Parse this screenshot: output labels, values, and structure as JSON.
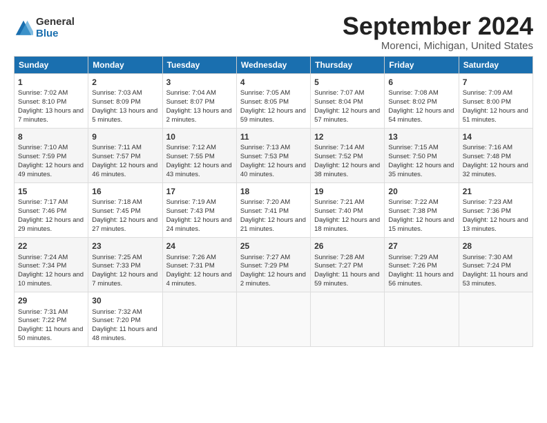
{
  "logo": {
    "general": "General",
    "blue": "Blue"
  },
  "title": "September 2024",
  "location": "Morenci, Michigan, United States",
  "days_of_week": [
    "Sunday",
    "Monday",
    "Tuesday",
    "Wednesday",
    "Thursday",
    "Friday",
    "Saturday"
  ],
  "weeks": [
    [
      {
        "day": "1",
        "sunrise": "7:02 AM",
        "sunset": "8:10 PM",
        "daylight": "13 hours and 7 minutes."
      },
      {
        "day": "2",
        "sunrise": "7:03 AM",
        "sunset": "8:09 PM",
        "daylight": "13 hours and 5 minutes."
      },
      {
        "day": "3",
        "sunrise": "7:04 AM",
        "sunset": "8:07 PM",
        "daylight": "13 hours and 2 minutes."
      },
      {
        "day": "4",
        "sunrise": "7:05 AM",
        "sunset": "8:05 PM",
        "daylight": "12 hours and 59 minutes."
      },
      {
        "day": "5",
        "sunrise": "7:07 AM",
        "sunset": "8:04 PM",
        "daylight": "12 hours and 57 minutes."
      },
      {
        "day": "6",
        "sunrise": "7:08 AM",
        "sunset": "8:02 PM",
        "daylight": "12 hours and 54 minutes."
      },
      {
        "day": "7",
        "sunrise": "7:09 AM",
        "sunset": "8:00 PM",
        "daylight": "12 hours and 51 minutes."
      }
    ],
    [
      {
        "day": "8",
        "sunrise": "7:10 AM",
        "sunset": "7:59 PM",
        "daylight": "12 hours and 49 minutes."
      },
      {
        "day": "9",
        "sunrise": "7:11 AM",
        "sunset": "7:57 PM",
        "daylight": "12 hours and 46 minutes."
      },
      {
        "day": "10",
        "sunrise": "7:12 AM",
        "sunset": "7:55 PM",
        "daylight": "12 hours and 43 minutes."
      },
      {
        "day": "11",
        "sunrise": "7:13 AM",
        "sunset": "7:53 PM",
        "daylight": "12 hours and 40 minutes."
      },
      {
        "day": "12",
        "sunrise": "7:14 AM",
        "sunset": "7:52 PM",
        "daylight": "12 hours and 38 minutes."
      },
      {
        "day": "13",
        "sunrise": "7:15 AM",
        "sunset": "7:50 PM",
        "daylight": "12 hours and 35 minutes."
      },
      {
        "day": "14",
        "sunrise": "7:16 AM",
        "sunset": "7:48 PM",
        "daylight": "12 hours and 32 minutes."
      }
    ],
    [
      {
        "day": "15",
        "sunrise": "7:17 AM",
        "sunset": "7:46 PM",
        "daylight": "12 hours and 29 minutes."
      },
      {
        "day": "16",
        "sunrise": "7:18 AM",
        "sunset": "7:45 PM",
        "daylight": "12 hours and 27 minutes."
      },
      {
        "day": "17",
        "sunrise": "7:19 AM",
        "sunset": "7:43 PM",
        "daylight": "12 hours and 24 minutes."
      },
      {
        "day": "18",
        "sunrise": "7:20 AM",
        "sunset": "7:41 PM",
        "daylight": "12 hours and 21 minutes."
      },
      {
        "day": "19",
        "sunrise": "7:21 AM",
        "sunset": "7:40 PM",
        "daylight": "12 hours and 18 minutes."
      },
      {
        "day": "20",
        "sunrise": "7:22 AM",
        "sunset": "7:38 PM",
        "daylight": "12 hours and 15 minutes."
      },
      {
        "day": "21",
        "sunrise": "7:23 AM",
        "sunset": "7:36 PM",
        "daylight": "12 hours and 13 minutes."
      }
    ],
    [
      {
        "day": "22",
        "sunrise": "7:24 AM",
        "sunset": "7:34 PM",
        "daylight": "12 hours and 10 minutes."
      },
      {
        "day": "23",
        "sunrise": "7:25 AM",
        "sunset": "7:33 PM",
        "daylight": "12 hours and 7 minutes."
      },
      {
        "day": "24",
        "sunrise": "7:26 AM",
        "sunset": "7:31 PM",
        "daylight": "12 hours and 4 minutes."
      },
      {
        "day": "25",
        "sunrise": "7:27 AM",
        "sunset": "7:29 PM",
        "daylight": "12 hours and 2 minutes."
      },
      {
        "day": "26",
        "sunrise": "7:28 AM",
        "sunset": "7:27 PM",
        "daylight": "11 hours and 59 minutes."
      },
      {
        "day": "27",
        "sunrise": "7:29 AM",
        "sunset": "7:26 PM",
        "daylight": "11 hours and 56 minutes."
      },
      {
        "day": "28",
        "sunrise": "7:30 AM",
        "sunset": "7:24 PM",
        "daylight": "11 hours and 53 minutes."
      }
    ],
    [
      {
        "day": "29",
        "sunrise": "7:31 AM",
        "sunset": "7:22 PM",
        "daylight": "11 hours and 50 minutes."
      },
      {
        "day": "30",
        "sunrise": "7:32 AM",
        "sunset": "7:20 PM",
        "daylight": "11 hours and 48 minutes."
      },
      null,
      null,
      null,
      null,
      null
    ]
  ]
}
